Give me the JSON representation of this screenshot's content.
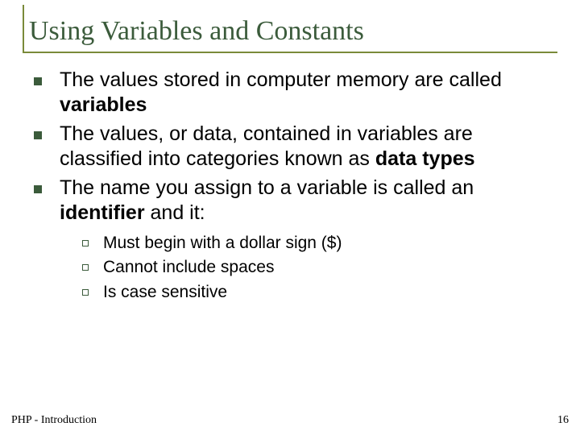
{
  "title": "Using Variables and Constants",
  "bullets": {
    "b1a": "The values stored in computer memory are called ",
    "b1b": "variables",
    "b2a": "The values, or data, contained in variables are classified into categories known as ",
    "b2b": "data types",
    "b3a": "The name you assign to a variable is called an ",
    "b3b": "identifier",
    "b3c": " and it:"
  },
  "subs": {
    "s1": "Must begin with a dollar sign ($)",
    "s2": "Cannot include spaces",
    "s3": "Is case sensitive"
  },
  "footer": {
    "left": "PHP - Introduction",
    "right": "16"
  }
}
